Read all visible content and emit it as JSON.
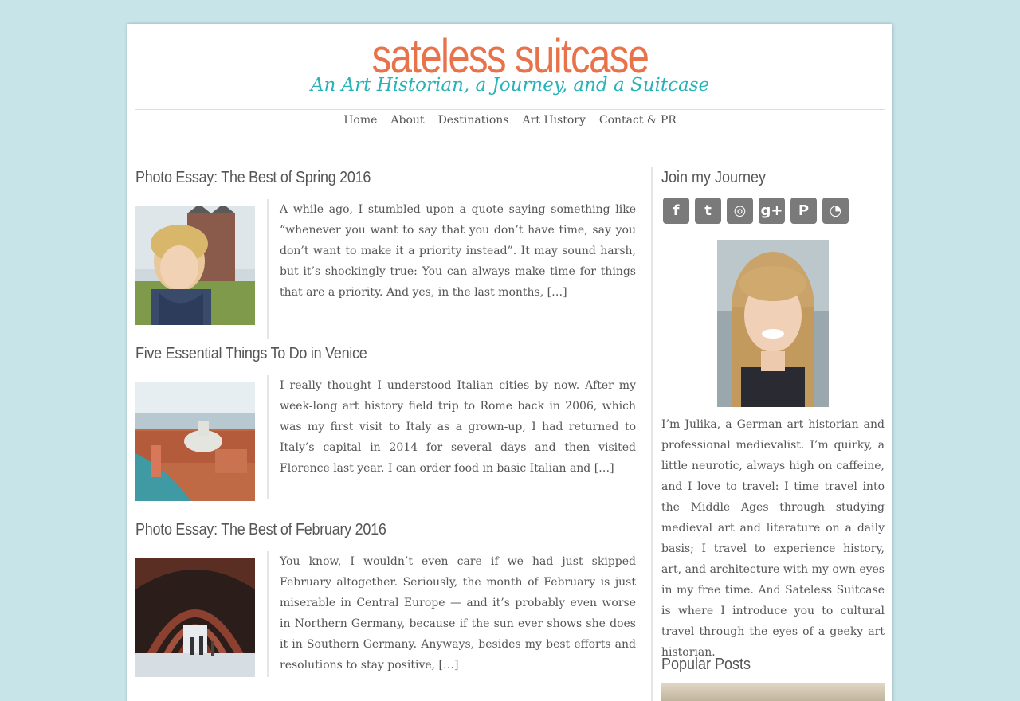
{
  "site": {
    "title": "sateless suitcase",
    "tagline": "An Art Historian, a Journey, and a Suitcase"
  },
  "nav": {
    "items": [
      "Home",
      "About",
      "Destinations",
      "Art History",
      "Contact & PR"
    ]
  },
  "posts": [
    {
      "title": "Photo Essay: The Best of Spring 2016",
      "excerpt": "A while ago, I stumbled upon a quote saying something like “whenever you want to say that you don’t have time, say you don’t want to make it a priority instead”. It may sound harsh, but it’s shockingly true: You can always make time for things that are a priority. And yes, in the last months, […]"
    },
    {
      "title": "Five Essential Things To Do in Venice",
      "excerpt": "I really thought I understood Italian cities by now. After my week-long art history field trip to Rome back in 2006, which was my first visit to Italy as a grown-up, I had returned to Italy’s capital in 2014 for several days and then visited Florence last year. I can order food in basic Italian and […]"
    },
    {
      "title": "Photo Essay: The Best of February 2016",
      "excerpt": "You know, I wouldn’t even care if we had just skipped February altogether. Seriously, the month of February is just miserable in Central Europe — and it’s probably even worse in Northern Germany, because if the sun ever shows she does it in Southern Germany. Anyways, besides my best efforts and resolutions to stay positive, […]"
    }
  ],
  "sidebar": {
    "join_title": "Join my Journey",
    "social": [
      {
        "icon": "facebook-icon",
        "glyph": "f"
      },
      {
        "icon": "twitter-icon",
        "glyph": "t"
      },
      {
        "icon": "instagram-icon",
        "glyph": "◎"
      },
      {
        "icon": "google-plus-icon",
        "glyph": "g+"
      },
      {
        "icon": "pinterest-icon",
        "glyph": "P"
      },
      {
        "icon": "rss-icon",
        "glyph": "◔"
      }
    ],
    "bio": "I’m Julika, a German art historian and professional medievalist. I’m quirky, a little neurotic, always high on caffeine, and I love to travel: I time travel into the Middle Ages through studying medieval art and literature on a daily basis; I travel to experience history, art, and architecture with my own eyes in my free time. And Sateless Suitcase is where I introduce you to cultural travel through the eyes of a geeky art historian.",
    "popular_title": "Popular Posts"
  },
  "colors": {
    "background": "#c7e4e9",
    "title": "#e8734a",
    "tagline": "#27b3b8",
    "icon": "#7a7a7a"
  }
}
